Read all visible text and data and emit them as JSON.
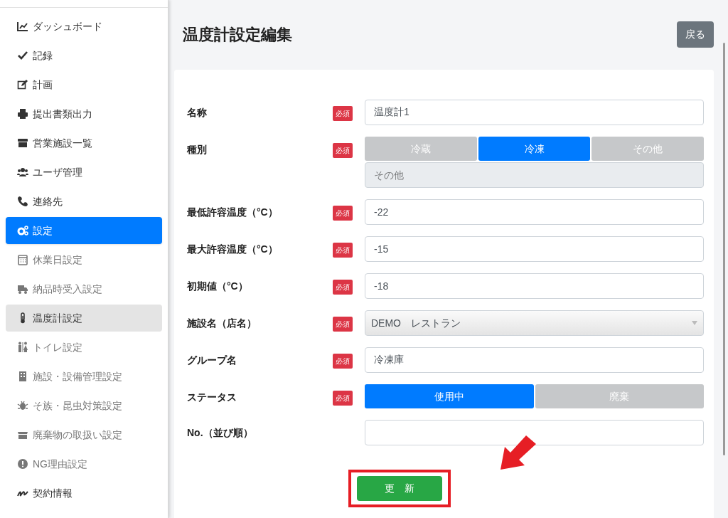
{
  "sidebar": {
    "items": [
      {
        "label": "ダッシュボード",
        "kind": "main",
        "selected": false
      },
      {
        "label": "記録",
        "kind": "main",
        "selected": false
      },
      {
        "label": "計画",
        "kind": "main",
        "selected": false
      },
      {
        "label": "提出書類出力",
        "kind": "main",
        "selected": false
      },
      {
        "label": "営業施設一覧",
        "kind": "main",
        "selected": false
      },
      {
        "label": "ユーザ管理",
        "kind": "main",
        "selected": false
      },
      {
        "label": "連絡先",
        "kind": "main",
        "selected": false
      },
      {
        "label": "設定",
        "kind": "main",
        "selected": true
      },
      {
        "label": "休業日設定",
        "kind": "sub",
        "selected": false
      },
      {
        "label": "納品時受入設定",
        "kind": "sub",
        "selected": false
      },
      {
        "label": "温度計設定",
        "kind": "sub",
        "selected": true
      },
      {
        "label": "トイレ設定",
        "kind": "sub",
        "selected": false
      },
      {
        "label": "施設・設備管理設定",
        "kind": "sub",
        "selected": false
      },
      {
        "label": "そ族・昆虫対策設定",
        "kind": "sub",
        "selected": false
      },
      {
        "label": "廃棄物の取扱い設定",
        "kind": "sub",
        "selected": false
      },
      {
        "label": "NG理由設定",
        "kind": "sub",
        "selected": false
      },
      {
        "label": "契約情報",
        "kind": "main",
        "selected": false
      }
    ]
  },
  "page": {
    "title": "温度計設定編集",
    "back_button": "戻る"
  },
  "form": {
    "fields": [
      {
        "label": "名称",
        "required": true,
        "required_badge": "必須",
        "kind": "text",
        "value": "温度計1"
      },
      {
        "label": "種別",
        "required": true,
        "required_badge": "必須",
        "kind": "segmented",
        "options": [
          {
            "label": "冷蔵",
            "selected": false
          },
          {
            "label": "冷凍",
            "selected": true
          },
          {
            "label": "その他",
            "selected": false
          }
        ],
        "other": {
          "placeholder": "その他",
          "disabled": true
        }
      },
      {
        "label": "最低許容温度（°C）",
        "required": true,
        "required_badge": "必須",
        "kind": "text",
        "value": "-22"
      },
      {
        "label": "最大許容温度（°C）",
        "required": true,
        "required_badge": "必須",
        "kind": "text",
        "value": "-15"
      },
      {
        "label": "初期値（°C）",
        "required": true,
        "required_badge": "必須",
        "kind": "text",
        "value": "-18"
      },
      {
        "label": "施設名（店名）",
        "required": true,
        "required_badge": "必須",
        "kind": "select",
        "value": "DEMO　レストラン"
      },
      {
        "label": "グループ名",
        "required": true,
        "required_badge": "必須",
        "kind": "text",
        "value": "冷凍庫"
      },
      {
        "label": "ステータス",
        "required": true,
        "required_badge": "必須",
        "kind": "segmented",
        "options": [
          {
            "label": "使用中",
            "selected": true
          },
          {
            "label": "廃棄",
            "selected": false
          }
        ]
      },
      {
        "label": "No.（並び順）",
        "required": false,
        "kind": "text"
      }
    ],
    "submit_button": "更　新"
  }
}
